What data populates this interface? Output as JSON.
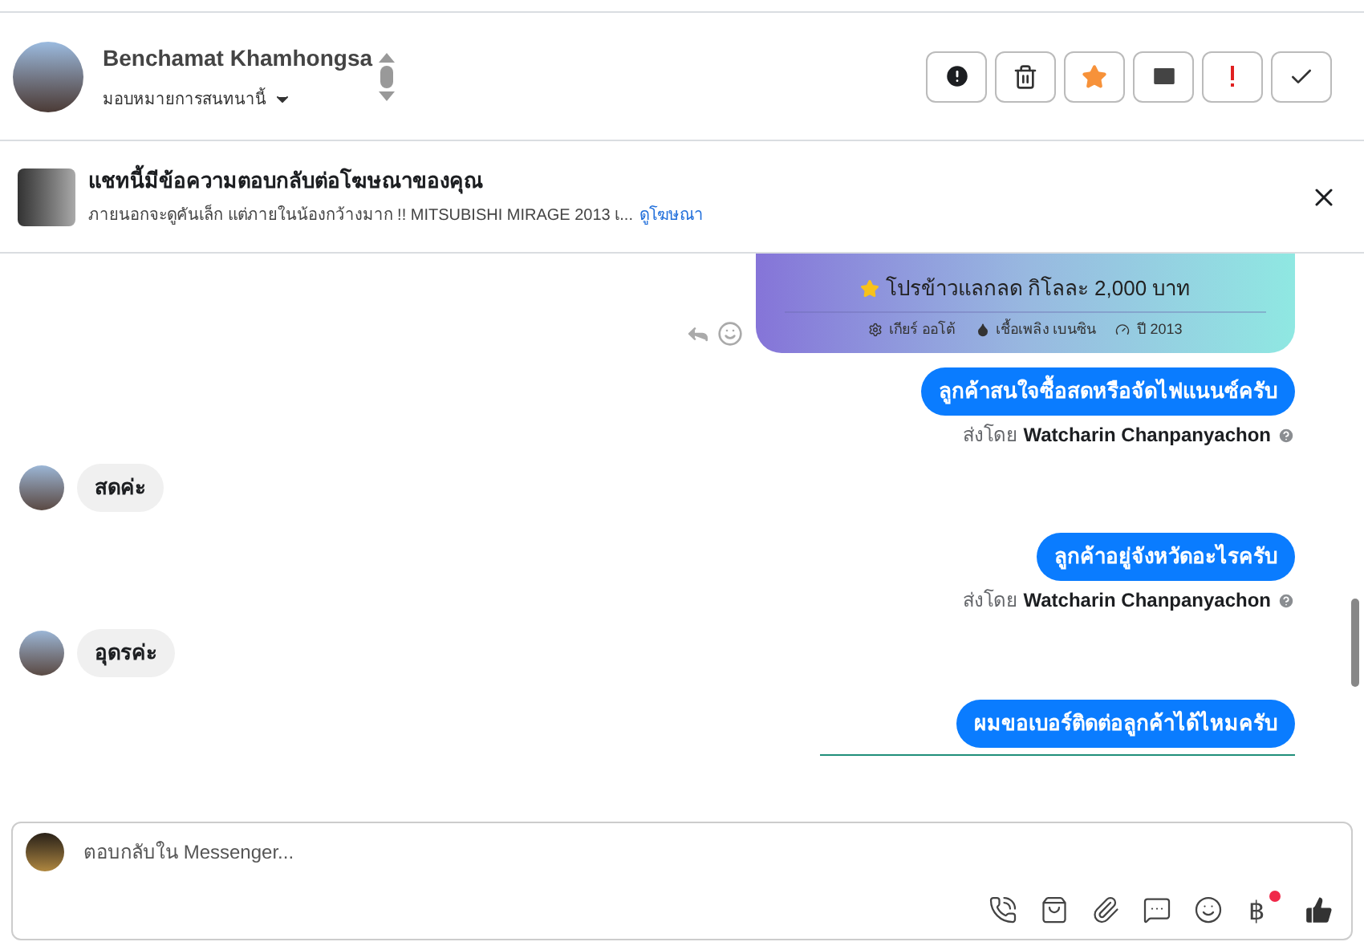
{
  "header": {
    "name": "Benchamat Khamhongsa",
    "assign_label": "มอบหมายการสนทนานี้",
    "actions": [
      {
        "kind": "spam"
      },
      {
        "kind": "delete"
      },
      {
        "kind": "star"
      },
      {
        "kind": "unread"
      },
      {
        "kind": "important"
      },
      {
        "kind": "done"
      }
    ]
  },
  "ad_banner": {
    "title": "แชทนี้มีข้อความตอบกลับต่อโฆษณาของคุณ",
    "subtitle": "ภายนอกจะดูคันเล็ก แต่ภายในน้องกว้างมาก !! MITSUBISHI MIRAGE 2013 เ...",
    "link": "ดูโฆษณา"
  },
  "messages": [
    {
      "kind": "ad_card",
      "promo": "โปรข้าวแลกลด กิโลละ 2,000 บาท",
      "specs": [
        {
          "kind": "gear",
          "text": "เกียร์ ออโต้"
        },
        {
          "kind": "fuel",
          "text": "เชื้อเพลิง เบนซิน"
        },
        {
          "kind": "year",
          "text": "ปี 2013"
        }
      ]
    },
    {
      "kind": "outgoing",
      "text": "ลูกค้าสนใจซื้อสดหรือจัดไฟแนนซ์ครับ",
      "sent_by_label": "ส่งโดย",
      "sender": "Watcharin Chanpanyachon"
    },
    {
      "kind": "incoming",
      "text": "สดค่ะ"
    },
    {
      "kind": "outgoing",
      "text": "ลูกค้าอยู่จังหวัดอะไรครับ",
      "sent_by_label": "ส่งโดย",
      "sender": "Watcharin Chanpanyachon"
    },
    {
      "kind": "incoming",
      "text": "อุดรค่ะ"
    },
    {
      "kind": "outgoing",
      "text": "ผมขอเบอร์ติดต่อลูกค้าได้ไหมครับ"
    }
  ],
  "composer": {
    "placeholder": "ตอบกลับใน Messenger...",
    "baht_symbol": "฿",
    "baht_badge": true
  }
}
